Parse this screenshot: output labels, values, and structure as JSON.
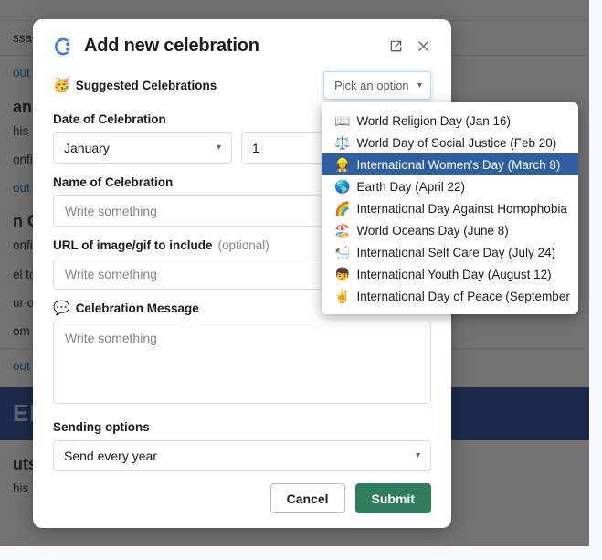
{
  "background": {
    "lines": [
      {
        "text": "ssages",
        "type": "body"
      },
      {
        "text": "out bi",
        "type": "link"
      },
      {
        "text": "anniv",
        "type": "head"
      },
      {
        "text": "his m",
        "type": "body"
      },
      {
        "text": "onfig",
        "type": "body"
      },
      {
        "text": "out w",
        "type": "link"
      },
      {
        "text": "n Cel",
        "type": "head"
      },
      {
        "text": "onfig",
        "type": "body"
      },
      {
        "text": "el to",
        "type": "body"
      },
      {
        "text": "ur of",
        "type": "body"
      },
      {
        "text": "om c",
        "type": "body"
      },
      {
        "text": "out cu",
        "type": "link"
      }
    ],
    "banner_text": "EN",
    "footer_head": "uts",
    "footer_line": "his message look like?"
  },
  "modal": {
    "title": "Add new celebration",
    "logo_name": "app-logo",
    "open_in_new_label": "Open in new window",
    "close_label": "Close",
    "suggested": {
      "emoji": "🥳",
      "label": "Suggested Celebrations",
      "select_value": "Pick an option"
    },
    "date": {
      "label": "Date of Celebration",
      "month_value": "January",
      "day_value": "1"
    },
    "name": {
      "label": "Name of Celebration",
      "placeholder": "Write something",
      "value": ""
    },
    "url": {
      "label": "URL of image/gif to include",
      "optional_suffix": "(optional)",
      "placeholder": "Write something",
      "value": ""
    },
    "message": {
      "emoji": "💬",
      "label": "Celebration Message",
      "placeholder": "Write something",
      "value": ""
    },
    "sending": {
      "label": "Sending options",
      "value": "Send every year"
    },
    "footer": {
      "cancel_label": "Cancel",
      "submit_label": "Submit"
    }
  },
  "dropdown": {
    "items": [
      {
        "emoji": "📖",
        "label": "World Religion Day (Jan 16)",
        "selected": false
      },
      {
        "emoji": "⚖️",
        "label": "World Day of Social Justice (Feb 20)",
        "selected": false
      },
      {
        "emoji": "👷‍♀️",
        "label": "International Women's Day (March 8)",
        "selected": true
      },
      {
        "emoji": "🌎",
        "label": "Earth Day (April 22)",
        "selected": false
      },
      {
        "emoji": "🌈",
        "label": "International Day Against Homophobia",
        "selected": false
      },
      {
        "emoji": "🏖️",
        "label": "World Oceans Day (June 8)",
        "selected": false
      },
      {
        "emoji": "🛀",
        "label": "International Self Care Day (July 24)",
        "selected": false
      },
      {
        "emoji": "👦",
        "label": "International Youth Day (August 12)",
        "selected": false
      },
      {
        "emoji": "✌️",
        "label": "International Day of Peace (September",
        "selected": false
      }
    ]
  },
  "colors": {
    "submit_green": "#2e7d5b",
    "dropdown_selected_blue": "#2e5fa3",
    "link_blue": "#1264a3",
    "banner_blue": "#1b3f94"
  }
}
